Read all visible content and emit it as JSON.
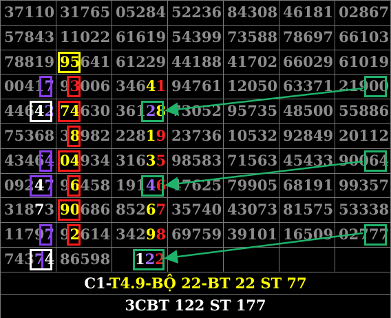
{
  "grid": {
    "rows": [
      [
        "37110",
        "31765",
        "05284",
        "52236",
        "84308",
        "46181",
        "02867"
      ],
      [
        "57843",
        "11022",
        "61619",
        "54399",
        "73588",
        "78697",
        "66103"
      ],
      [
        "78819",
        "95641",
        "61229",
        "44188",
        "41702",
        "66029",
        "61019"
      ],
      [
        "00417",
        "93006",
        "34641",
        "94761",
        "12050",
        "63371",
        "21900"
      ],
      [
        "44642",
        "74630",
        "36128",
        "73052",
        "95735",
        "48500",
        "55886"
      ],
      [
        "75368",
        "38982",
        "22819",
        "23736",
        "10532",
        "92849",
        "20112"
      ],
      [
        "43464",
        "04934",
        "31635",
        "98583",
        "71563",
        "45433",
        "90064"
      ],
      [
        "09247",
        "96458",
        "19146",
        "47625",
        "79905",
        "68191",
        "99357"
      ],
      [
        "31873",
        "90686",
        "85267",
        "35740",
        "43073",
        "81575",
        "53338"
      ],
      [
        "11797",
        "92614",
        "34298",
        "69759",
        "39101",
        "16509",
        "02777"
      ],
      [
        "74374",
        "86598",
        "122",
        "",
        "",
        "",
        ""
      ]
    ]
  },
  "footer": {
    "line1_prefix": "C1-",
    "line1_rest": "T4.9-BỘ 22-BT 22 ST 77",
    "line2": "3CBT 122 ST 177"
  },
  "colors": {
    "grey_text": "#8c8c8c",
    "yellow": "#ffff00",
    "red": "#ff1a1a",
    "purple": "#8a3df0",
    "green": "#1fb36a",
    "white": "#ffffff"
  }
}
